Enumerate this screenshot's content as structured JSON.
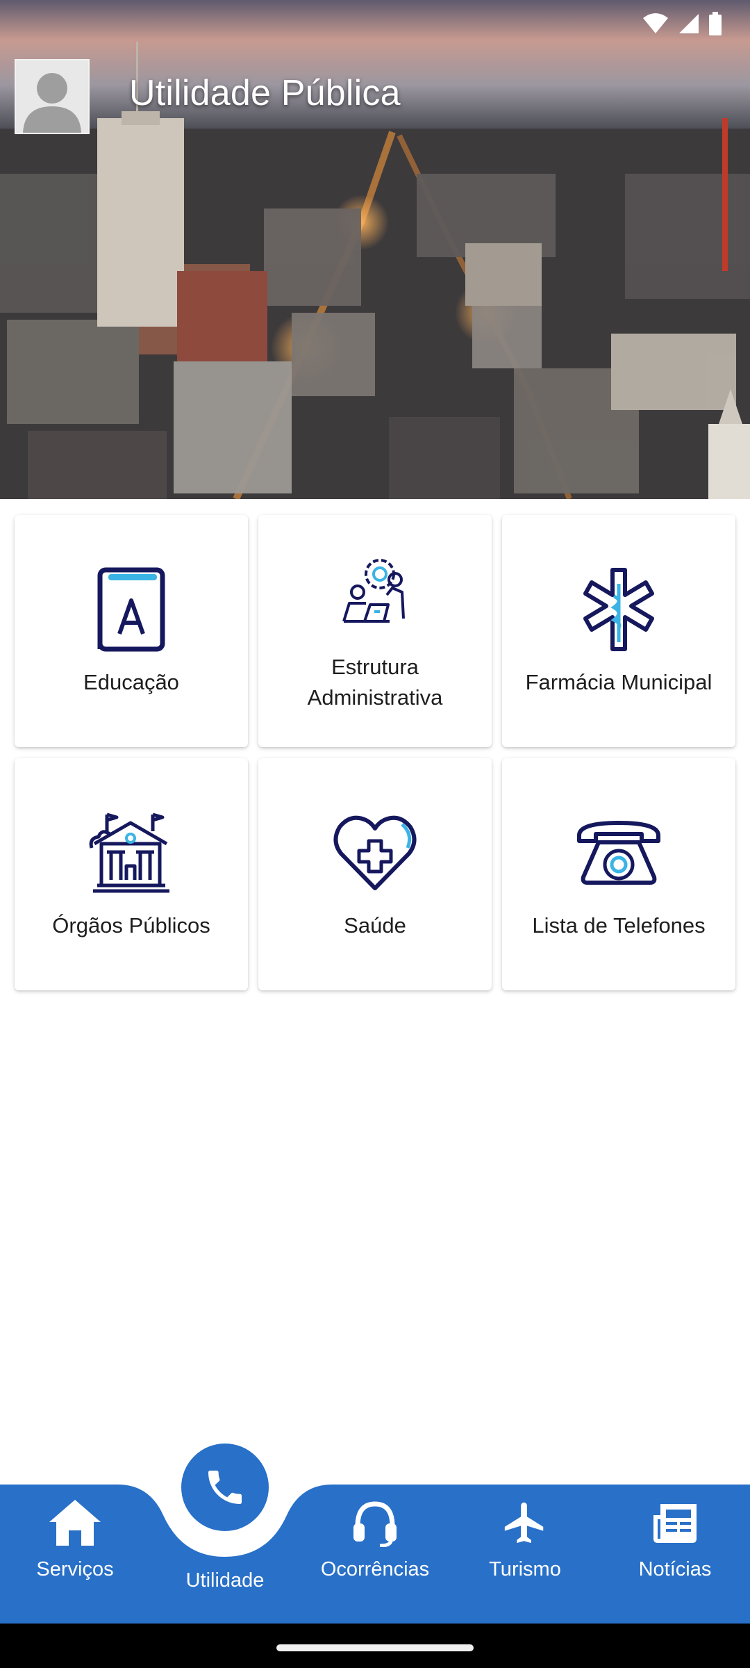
{
  "header": {
    "title": "Utilidade Pública"
  },
  "grid": {
    "items": [
      {
        "label": "Educação",
        "icon": "book-icon"
      },
      {
        "label": "Estrutura\nAdministrativa",
        "icon": "admin-structure-icon"
      },
      {
        "label": "Farmácia Municipal",
        "icon": "star-of-life-icon"
      },
      {
        "label": "Órgãos Públicos",
        "icon": "public-building-icon"
      },
      {
        "label": "Saúde",
        "icon": "health-heart-icon"
      },
      {
        "label": "Lista de Telefones",
        "icon": "telephone-icon"
      }
    ]
  },
  "bottom_nav": {
    "items": [
      {
        "label": "Serviços",
        "icon": "home-icon"
      },
      {
        "label": "Utilidade",
        "icon": "phone-icon",
        "active": true
      },
      {
        "label": "Ocorrências",
        "icon": "headset-icon"
      },
      {
        "label": "Turismo",
        "icon": "airplane-icon"
      },
      {
        "label": "Notícias",
        "icon": "newspaper-icon"
      }
    ]
  },
  "colors": {
    "primary": "#2870c8",
    "icon_dark": "#16185e",
    "icon_accent": "#3bb4e5",
    "card_text": "#1e1e1e"
  }
}
